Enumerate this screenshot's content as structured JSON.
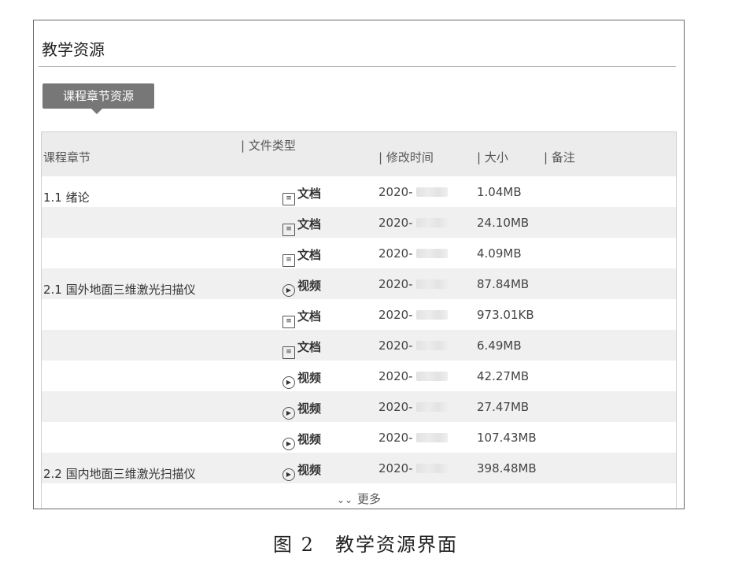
{
  "panel": {
    "title": "教学资源",
    "tab_label": "课程章节资源"
  },
  "table": {
    "headers": {
      "chapter": "课程章节",
      "type": "| 文件类型",
      "time": "| 修改时间",
      "size": "| 大小",
      "note": "| 备注"
    },
    "rows": [
      {
        "chapter": "1.1 绪论",
        "type": "文档",
        "type_icon": "document-icon",
        "time": "2020-",
        "size": "1.04MB"
      },
      {
        "chapter": "",
        "type": "文档",
        "type_icon": "document-icon",
        "time": "2020-",
        "size": "24.10MB"
      },
      {
        "chapter": "",
        "type": "文档",
        "type_icon": "document-icon",
        "time": "2020-",
        "size": "4.09MB"
      },
      {
        "chapter": "2.1 国外地面三维激光扫描仪",
        "type": "视频",
        "type_icon": "video-icon",
        "time": "2020-",
        "size": "87.84MB"
      },
      {
        "chapter": "",
        "type": "文档",
        "type_icon": "document-icon",
        "time": "2020-",
        "size": "973.01KB"
      },
      {
        "chapter": "",
        "type": "文档",
        "type_icon": "document-icon",
        "time": "2020-",
        "size": "6.49MB"
      },
      {
        "chapter": "",
        "type": "视频",
        "type_icon": "video-icon",
        "time": "2020-",
        "size": "42.27MB"
      },
      {
        "chapter": "",
        "type": "视频",
        "type_icon": "video-icon",
        "time": "2020-",
        "size": "27.47MB"
      },
      {
        "chapter": "",
        "type": "视频",
        "type_icon": "video-icon",
        "time": "2020-",
        "size": "107.43MB"
      },
      {
        "chapter": "2.2 国内地面三维激光扫描仪",
        "type": "视频",
        "type_icon": "video-icon",
        "time": "2020-",
        "size": "398.48MB"
      }
    ],
    "more_label": "更多"
  },
  "caption": "图 2　教学资源界面"
}
